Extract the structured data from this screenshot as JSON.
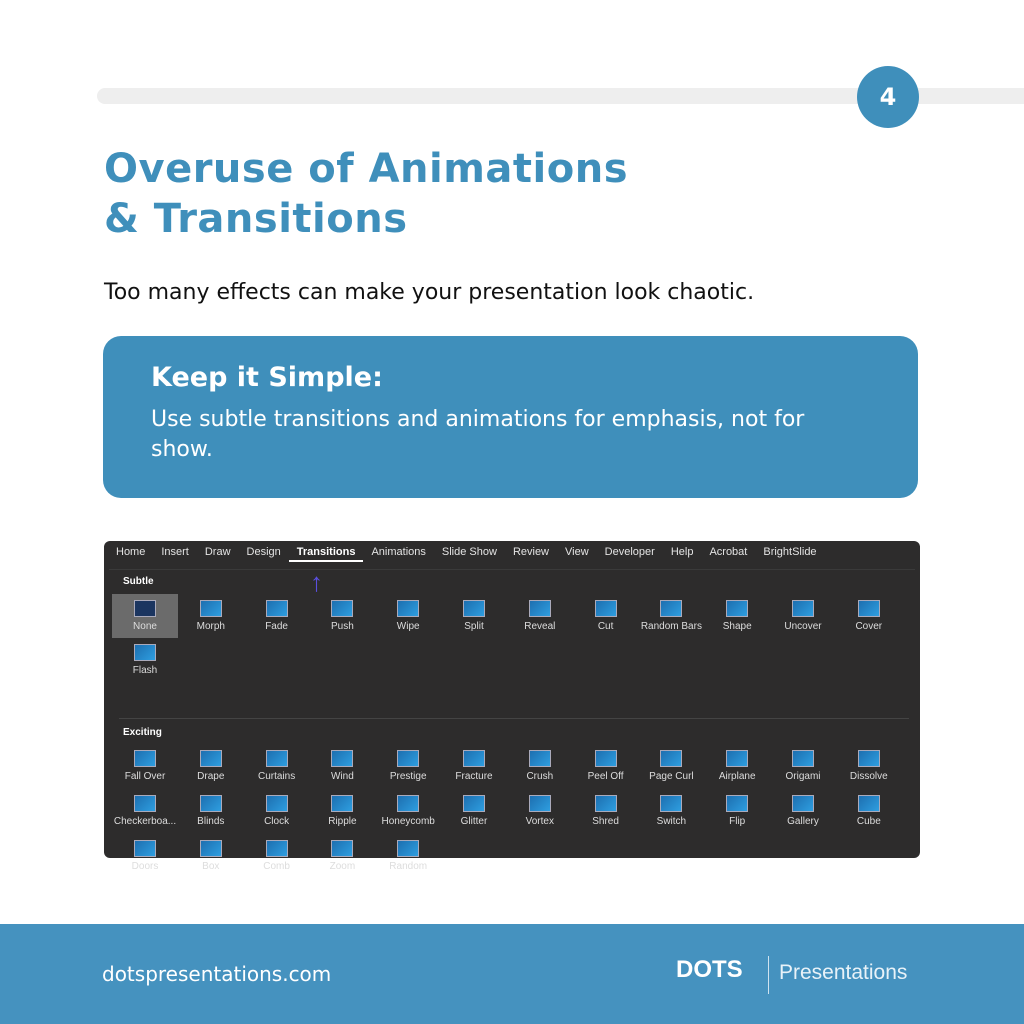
{
  "page_number": "4",
  "title_line1": "Overuse of Animations",
  "title_line2": "& Transitions",
  "subtitle": "Too many effects can make your presentation look chaotic.",
  "tip": {
    "heading": "Keep it Simple:",
    "body": "Use subtle transitions and animations for emphasis, not for show."
  },
  "ribbon": {
    "tabs": [
      "Home",
      "Insert",
      "Draw",
      "Design",
      "Transitions",
      "Animations",
      "Slide Show",
      "Review",
      "View",
      "Developer",
      "Help",
      "Acrobat",
      "BrightSlide"
    ],
    "active_tab": "Transitions",
    "subtle_label": "Subtle",
    "subtle": [
      "None",
      "Morph",
      "Fade",
      "Push",
      "Wipe",
      "Split",
      "Reveal",
      "Cut",
      "Random Bars",
      "Shape",
      "Uncover",
      "Cover",
      "Flash"
    ],
    "selected": "None",
    "exciting_label": "Exciting",
    "exciting": [
      "Fall Over",
      "Drape",
      "Curtains",
      "Wind",
      "Prestige",
      "Fracture",
      "Crush",
      "Peel Off",
      "Page Curl",
      "Airplane",
      "Origami",
      "Dissolve",
      "Checkerboa...",
      "Blinds",
      "Clock",
      "Ripple",
      "Honeycomb",
      "Glitter",
      "Vortex",
      "Shred",
      "Switch",
      "Flip",
      "Gallery",
      "Cube",
      "Doors",
      "Box",
      "Comb",
      "Zoom",
      "Random"
    ],
    "arrow_color": "#5b4fe0"
  },
  "footer": {
    "website": "dotspresentations.com",
    "logo": "DOTS",
    "brand": "Presentations"
  },
  "colors": {
    "accent": "#3f8fbb",
    "footer": "#4592bf"
  }
}
